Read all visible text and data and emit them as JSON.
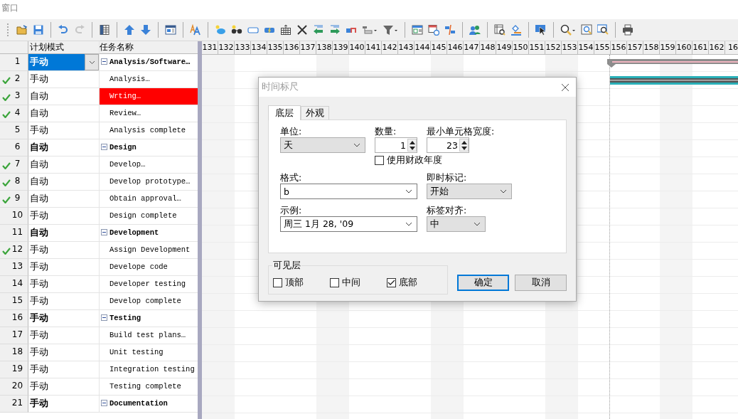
{
  "window": {
    "title": "窗口"
  },
  "toolbar": [
    {
      "disabled": false
    },
    {
      "disabled": false
    },
    {
      "disabled": false
    },
    {
      "disabled": true
    },
    {
      "disabled": false
    },
    {
      "disabled": false
    },
    {
      "disabled": false
    },
    {
      "disabled": false
    },
    {
      "disabled": false
    },
    {
      "disabled": false
    },
    {
      "disabled": false
    },
    {
      "disabled": false
    },
    {
      "disabled": false
    },
    {
      "disabled": false
    },
    {
      "disabled": false
    },
    {
      "disabled": false
    },
    {
      "disabled": false
    },
    {
      "disabled": false
    },
    {
      "disabled": false
    },
    {
      "disabled": false
    },
    {
      "disabled": false
    },
    {
      "disabled": false
    },
    {
      "disabled": false
    },
    {
      "disabled": false
    },
    {
      "disabled": false
    },
    {
      "disabled": false
    },
    {
      "disabled": false
    },
    {
      "disabled": false
    },
    {
      "disabled": false
    },
    {
      "disabled": false
    },
    {
      "disabled": false
    }
  ],
  "table": {
    "columns": [
      "计划模式",
      "任务名称"
    ],
    "rows": [
      {
        "id": "1",
        "mode": "手动",
        "name": "Analysis/Software…",
        "summary": true,
        "done": false,
        "selected": true,
        "highlighted": false,
        "kind": "summary"
      },
      {
        "id": "2",
        "mode": "手动",
        "name": "Analysis…",
        "summary": false,
        "done": true,
        "selected": false,
        "highlighted": false,
        "kind": "task"
      },
      {
        "id": "3",
        "mode": "自动",
        "name": "Wrting…",
        "summary": false,
        "done": true,
        "selected": false,
        "highlighted": true
      },
      {
        "id": "4",
        "mode": "自动",
        "name": "Review…",
        "summary": false,
        "done": true,
        "selected": false,
        "highlighted": false
      },
      {
        "id": "5",
        "mode": "手动",
        "name": "Analysis complete",
        "summary": false,
        "done": false,
        "selected": false,
        "highlighted": false
      },
      {
        "id": "6",
        "mode": "自动",
        "name": "Design",
        "summary": true,
        "done": false,
        "selected": false,
        "highlighted": false
      },
      {
        "id": "7",
        "mode": "自动",
        "name": "Develop…",
        "summary": false,
        "done": true,
        "selected": false,
        "highlighted": false
      },
      {
        "id": "8",
        "mode": "自动",
        "name": "Develop prototype…",
        "summary": false,
        "done": true,
        "selected": false,
        "highlighted": false
      },
      {
        "id": "9",
        "mode": "自动",
        "name": "Obtain approval…",
        "summary": false,
        "done": true,
        "selected": false,
        "highlighted": false
      },
      {
        "id": "10",
        "mode": "手动",
        "name": "Design complete",
        "summary": false,
        "done": false,
        "selected": false,
        "highlighted": false
      },
      {
        "id": "11",
        "mode": "自动",
        "name": "Development",
        "summary": true,
        "done": false,
        "selected": false,
        "highlighted": false
      },
      {
        "id": "12",
        "mode": "手动",
        "name": "Assign Development",
        "summary": false,
        "done": true,
        "selected": false,
        "highlighted": false
      },
      {
        "id": "13",
        "mode": "手动",
        "name": "Develope code",
        "summary": false,
        "done": false,
        "selected": false,
        "highlighted": false
      },
      {
        "id": "14",
        "mode": "手动",
        "name": "Developer testing",
        "summary": false,
        "done": false,
        "selected": false,
        "highlighted": false
      },
      {
        "id": "15",
        "mode": "手动",
        "name": "Develop complete",
        "summary": false,
        "done": false,
        "selected": false,
        "highlighted": false
      },
      {
        "id": "16",
        "mode": "手动",
        "name": "Testing",
        "summary": true,
        "done": false,
        "selected": false,
        "highlighted": false
      },
      {
        "id": "17",
        "mode": "手动",
        "name": "Build test plans…",
        "summary": false,
        "done": false,
        "selected": false,
        "highlighted": false
      },
      {
        "id": "18",
        "mode": "手动",
        "name": "Unit testing",
        "summary": false,
        "done": false,
        "selected": false,
        "highlighted": false
      },
      {
        "id": "19",
        "mode": "手动",
        "name": "Integration testing",
        "summary": false,
        "done": false,
        "selected": false,
        "highlighted": false
      },
      {
        "id": "20",
        "mode": "手动",
        "name": "Testing complete",
        "summary": false,
        "done": false,
        "selected": false,
        "highlighted": false
      },
      {
        "id": "21",
        "mode": "手动",
        "name": "Documentation",
        "summary": true,
        "done": false,
        "selected": false,
        "highlighted": false
      }
    ]
  },
  "timescale": [
    "131",
    "132",
    "133",
    "134",
    "135",
    "136",
    "137",
    "138",
    "139",
    "140",
    "141",
    "142",
    "143",
    "144",
    "145",
    "146",
    "147",
    "148",
    "149",
    "150",
    "151",
    "152",
    "153",
    "154",
    "155",
    "156",
    "157",
    "158",
    "159",
    "160",
    "161",
    "162",
    "16"
  ],
  "dialog": {
    "title": "时间标尺",
    "tabs": [
      {
        "label": "底层",
        "selected": true
      },
      {
        "label": "外观",
        "selected": false
      }
    ],
    "unit": {
      "label": "单位:",
      "value": "天"
    },
    "count": {
      "label": "数量:",
      "value": "1"
    },
    "min_width": {
      "label": "最小单元格宽度:",
      "value": "23"
    },
    "fiscal_year": {
      "label": "使用财政年度",
      "checked": false
    },
    "format": {
      "label": "格式:",
      "value": "b"
    },
    "marker": {
      "label": "即时标记:",
      "value": "开始"
    },
    "sample": {
      "label": "示例:",
      "value": "周三 1月 28, '09"
    },
    "align": {
      "label": "标签对齐:",
      "value": "中"
    },
    "visible_tiers": {
      "label": "可见层",
      "options": [
        {
          "label": "顶部",
          "checked": false
        },
        {
          "label": "中间",
          "checked": false
        },
        {
          "label": "底部",
          "checked": true
        }
      ]
    },
    "buttons": [
      {
        "label": "确定",
        "default": true
      },
      {
        "label": "取消",
        "default": false
      }
    ]
  }
}
